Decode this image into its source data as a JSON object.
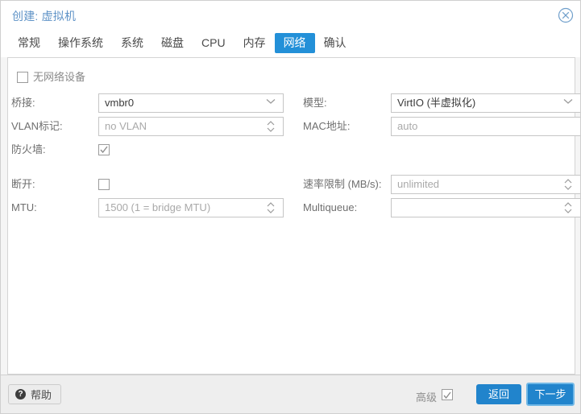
{
  "window": {
    "title": "创建: 虚拟机",
    "close_icon": "close-circle-icon"
  },
  "tabs": [
    {
      "label": "常规",
      "active": false
    },
    {
      "label": "操作系统",
      "active": false
    },
    {
      "label": "系统",
      "active": false
    },
    {
      "label": "磁盘",
      "active": false
    },
    {
      "label": "CPU",
      "active": false
    },
    {
      "label": "内存",
      "active": false
    },
    {
      "label": "网络",
      "active": true
    },
    {
      "label": "确认",
      "active": false
    }
  ],
  "form": {
    "no_network_device": {
      "label": "无网络设备",
      "checked": false
    },
    "bridge": {
      "label": "桥接:",
      "value": "vmbr0",
      "is_placeholder": false,
      "control": "combobox"
    },
    "vlan_tag": {
      "label": "VLAN标记:",
      "value": "no VLAN",
      "is_placeholder": true,
      "control": "spinner"
    },
    "firewall": {
      "label": "防火墙:",
      "checked": true
    },
    "model": {
      "label": "模型:",
      "value": "VirtIO (半虚拟化)",
      "is_placeholder": false,
      "control": "combobox"
    },
    "mac_address": {
      "label": "MAC地址:",
      "value": "auto",
      "is_placeholder": true,
      "control": "text"
    },
    "disconnect": {
      "label": "断开:",
      "checked": false
    },
    "mtu": {
      "label": "MTU:",
      "value": "1500 (1 = bridge MTU)",
      "is_placeholder": true,
      "control": "spinner"
    },
    "rate_limit": {
      "label": "速率限制 (MB/s):",
      "value": "unlimited",
      "is_placeholder": true,
      "control": "spinner"
    },
    "multiqueue": {
      "label": "Multiqueue:",
      "value": "",
      "is_placeholder": true,
      "control": "spinner"
    }
  },
  "footer": {
    "help_label": "帮助",
    "help_icon": "question-mark-icon",
    "advanced_label": "高级",
    "advanced_checked": true,
    "back_label": "返回",
    "next_label": "下一步"
  },
  "colors": {
    "accent": "#2184cc",
    "active_tab_bg": "#2390d8",
    "title_text": "#5f93c7",
    "panel_bg": "#ffffff",
    "window_bg": "#f5f5f5",
    "footer_bg": "#eeeeee"
  }
}
